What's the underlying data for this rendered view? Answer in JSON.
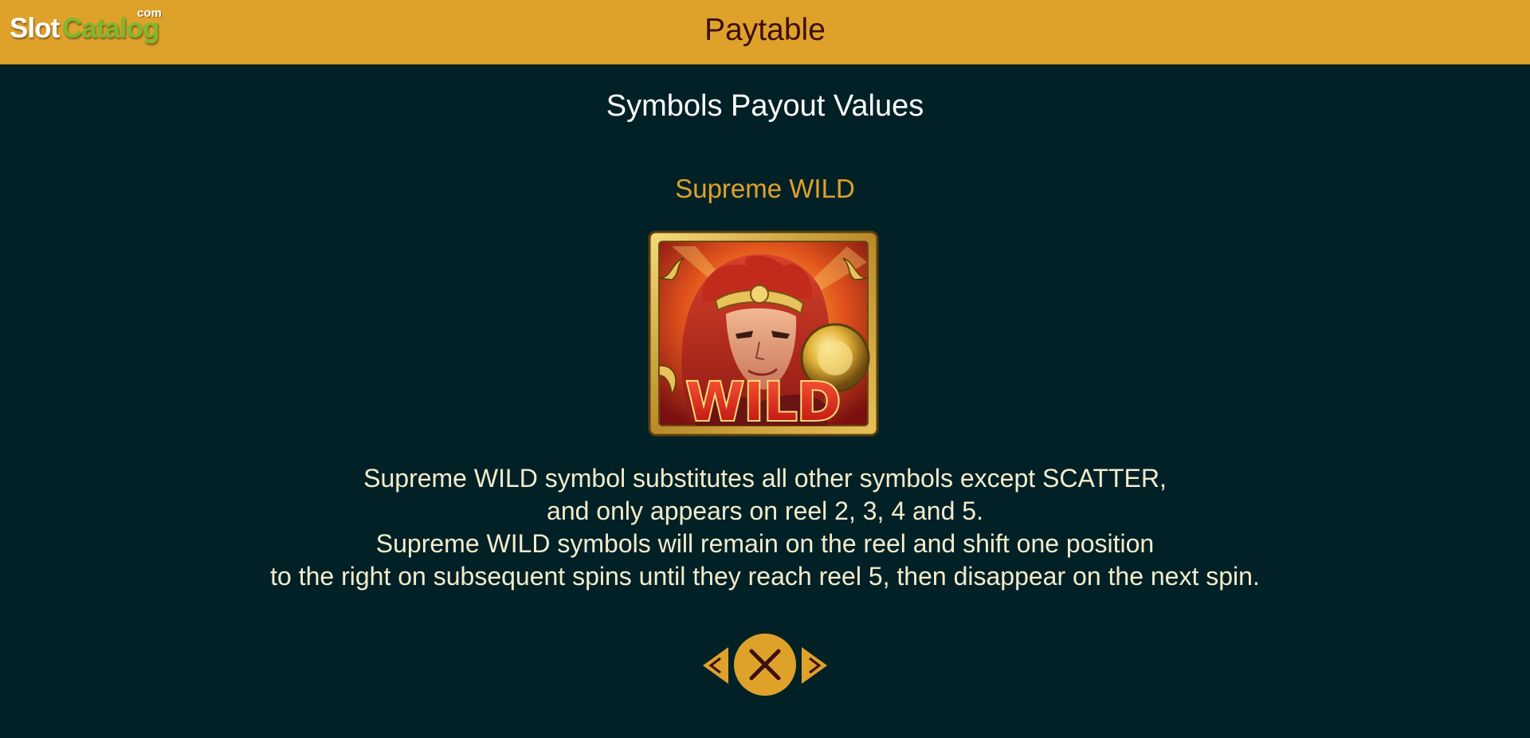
{
  "header": {
    "logo": {
      "part1": "Slot",
      "part2": "Catalog",
      "suffix": "com"
    },
    "title": "Paytable"
  },
  "section": {
    "title": "Symbols Payout Values"
  },
  "symbol": {
    "name": "Supreme WILD",
    "image_label": "WILD",
    "icon": "monkey-king-wild-icon"
  },
  "description": {
    "lines": [
      "Supreme WILD symbol substitutes all other symbols except SCATTER,",
      "and only appears on reel 2, 3, 4 and 5.",
      "Supreme WILD symbols will remain on the reel and shift one position",
      "to the right on subsequent spins until they reach reel 5, then disappear on the next spin."
    ]
  },
  "navigation": {
    "prev_icon": "chevron-left-icon",
    "close_icon": "close-icon",
    "next_icon": "chevron-right-icon"
  },
  "colors": {
    "header_bg": "#dea22a",
    "page_bg": "#022127",
    "accent_gold": "#dea22a",
    "title_dark": "#3d0f0f",
    "body_text": "#f3eccb",
    "logo_green": "#7fb82e"
  }
}
